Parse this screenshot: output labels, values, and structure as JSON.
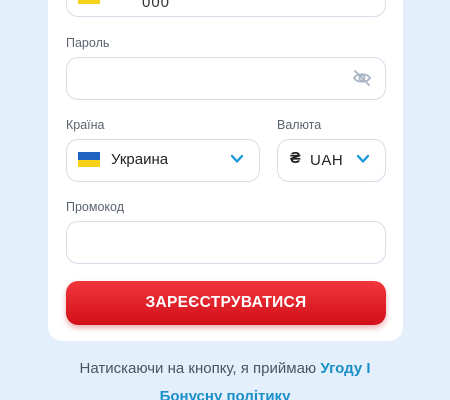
{
  "phone": {
    "value": "000"
  },
  "password": {
    "label": "Пароль",
    "value": ""
  },
  "country": {
    "label": "Країна",
    "value": "Украина"
  },
  "currency": {
    "label": "Валюта",
    "sign": "₴",
    "value": "UAH"
  },
  "promo": {
    "label": "Промокод",
    "value": ""
  },
  "submit_label": "ЗАРЕЄСТРУВАТИСЯ",
  "consent": {
    "text": "Натискаючи на кнопку, я приймаю ",
    "link1": "Угоду І",
    "link2": "Бонусну політику"
  },
  "colors": {
    "accent_red": "#e2222a",
    "link_blue": "#1a8fc8",
    "chevron_blue": "#1a9ad8",
    "page_bg": "#e3effb"
  },
  "icons": {
    "password_toggle": "eye-slash-icon",
    "dropdown": "chevron-down-icon"
  }
}
